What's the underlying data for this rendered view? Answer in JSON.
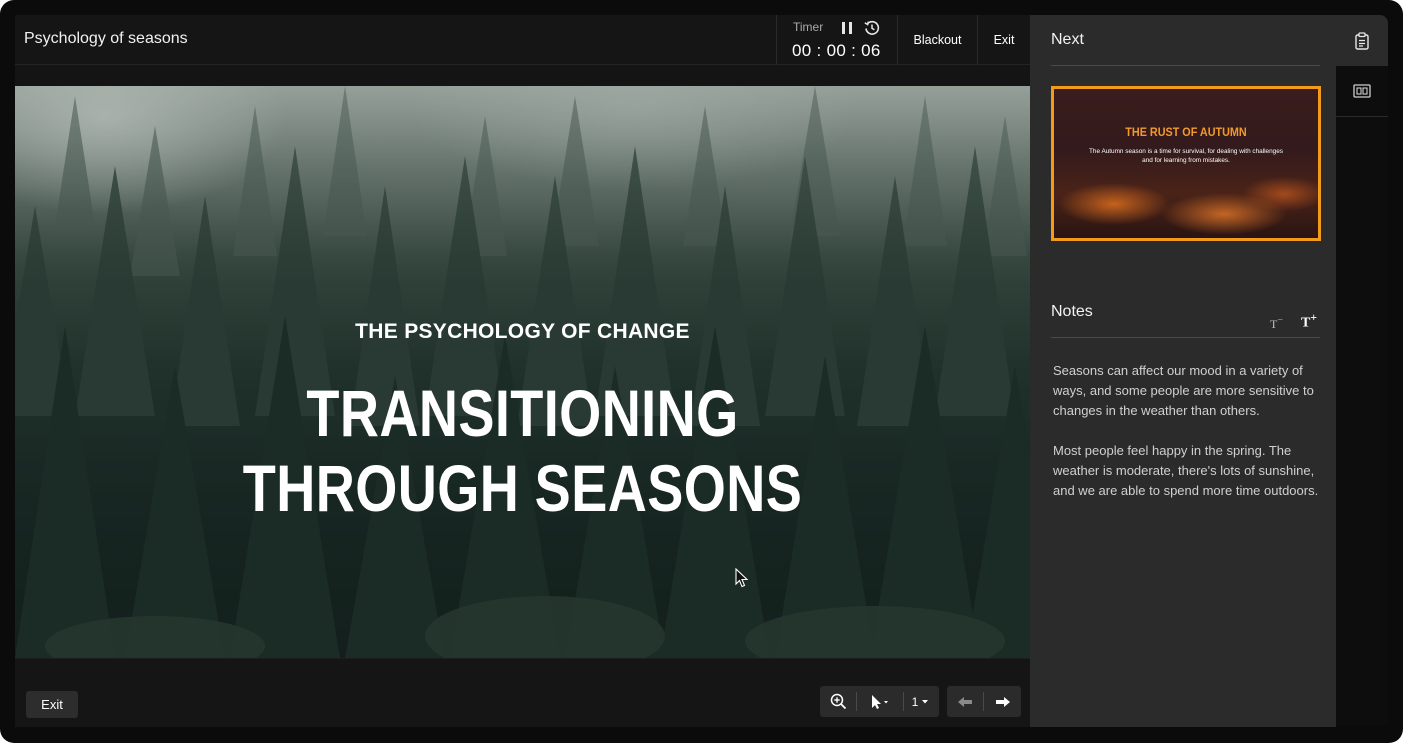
{
  "header": {
    "title": "Psychology of seasons",
    "timer_label": "Timer",
    "timer_value": "00 : 00 : 06",
    "blackout_label": "Blackout",
    "exit_label": "Exit"
  },
  "slide": {
    "subtitle": "THE PSYCHOLOGY OF CHANGE",
    "title": "TRANSITIONING THROUGH SEASONS"
  },
  "footer": {
    "exit_label": "Exit",
    "pen_size": "1"
  },
  "panel": {
    "next_heading": "Next",
    "next_slide": {
      "title": "THE RUST OF AUTUMN",
      "body": "The Autumn season is a time for survival, for dealing with challenges and for learning from mistakes."
    },
    "notes_heading": "Notes",
    "font_decrease_label": "T",
    "font_increase_label": "T",
    "notes": [
      "Seasons can affect our mood in a variety of ways, and some people are more sensitive to changes in the weather than others.",
      "Most people feel happy in the spring. The weather is moderate, there's lots of sunshine, and we are able to spend more time outdoors."
    ]
  },
  "icons": {
    "pause": "pause-icon",
    "reset": "reset-timer-icon",
    "zoom": "zoom-in-icon",
    "pointer": "pointer-icon",
    "prev": "arrow-left-icon",
    "next": "arrow-right-icon",
    "notes_tab": "clipboard-icon",
    "slides_tab": "slides-icon"
  },
  "colors": {
    "accent": "#f29a1a",
    "panel_bg": "#2b2b2b",
    "app_bg": "#141414"
  }
}
